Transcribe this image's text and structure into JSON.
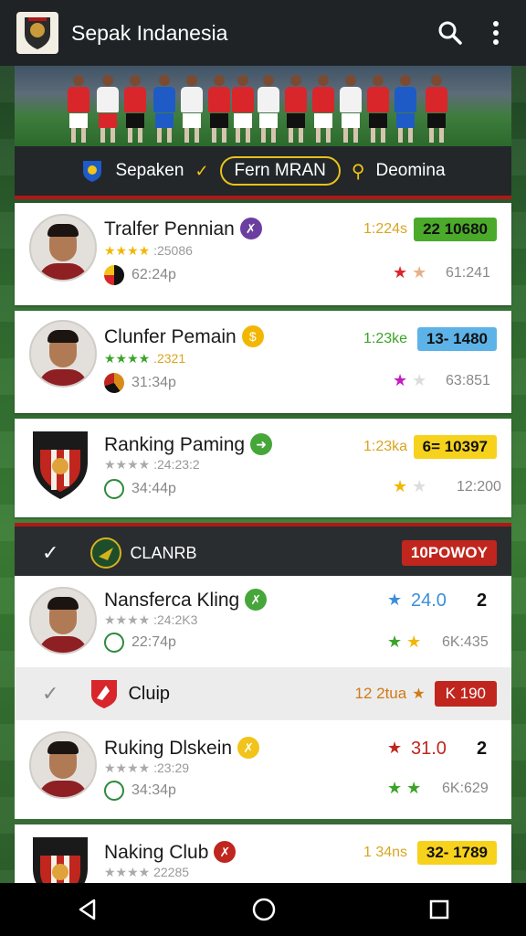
{
  "app": {
    "title": "Sepak Indanesia",
    "logo_icon": "club-shield-logo",
    "search_icon": "search-icon",
    "menu_icon": "more-vertical-icon"
  },
  "filters": {
    "club": "Sepaken",
    "tab": "Fern MRAN",
    "search": "Deomina"
  },
  "players": [
    {
      "name": "Tralfer Pennian",
      "stars_text": ":25086",
      "rating_stars": 4,
      "sub_text": "62:24p",
      "right_value": "1:224s",
      "score": "22 10680",
      "score_color": "#4caa2a",
      "star_count": "61:241",
      "tag_color": "#6b3fa0"
    },
    {
      "name": "Clunfer Pemain",
      "stars_text": ".2321",
      "rating_stars": 4,
      "sub_text": "31:34p",
      "right_value": "1:23ke",
      "score": "13- 1480",
      "score_color": "#5db3e8",
      "star_count": "63:851",
      "tag_color": "#f2b705"
    },
    {
      "name": "Ranking Paming",
      "stars_text": ":24:23:2",
      "rating_stars": 4,
      "sub_text": "34:44p",
      "right_value": "1:23ka",
      "score": "6= 10397",
      "score_color": "#f7d21c",
      "star_count": "12:200",
      "tag_color": "#46a63a"
    }
  ],
  "section1": {
    "title": "CLANRB",
    "badge": "10POWOY"
  },
  "section1_row": {
    "name": "Nansferca Kling",
    "stars_text": ":24:2K3",
    "sub_text": "22:74p",
    "rating": "24.0",
    "rank": "2",
    "star_count": "6K:435",
    "tag_color": "#46a63a"
  },
  "section2": {
    "title": "Cluip",
    "value": "12 2tua",
    "badge": "K 190"
  },
  "section2_rows": [
    {
      "name": "Ruking Dlskein",
      "stars_text": ":23:29",
      "sub_text": "34:34p",
      "rating": "31.0",
      "rank": "2",
      "star_count": "6K:629",
      "tag_color": "#f2c318"
    },
    {
      "name": "Naking Club",
      "stars_text": "22285",
      "right_value": "1 34ns",
      "score": "32- 1789",
      "tag_color": "#c0261e"
    }
  ],
  "nav": {
    "back": "back-icon",
    "home": "home-icon",
    "recents": "recents-icon"
  },
  "colors": {
    "accent_red": "#b01818",
    "accent_yellow": "#e7c21a",
    "appbar": "#1f2326"
  }
}
